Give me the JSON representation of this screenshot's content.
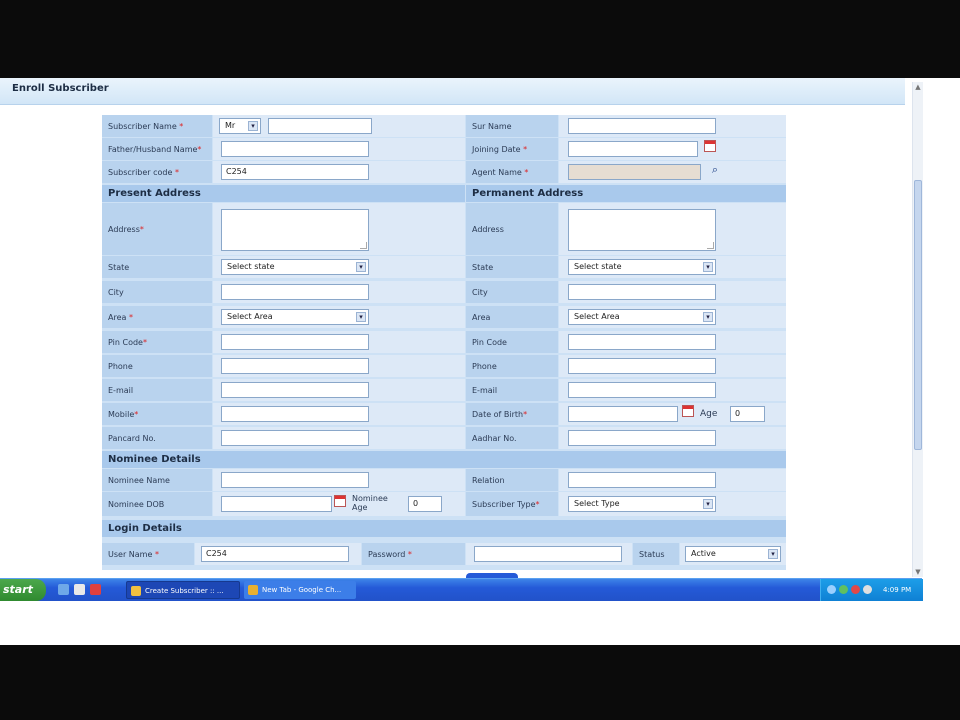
{
  "page": {
    "title": "Enroll Subscriber"
  },
  "form": {
    "subscriber_name": {
      "label": "Subscriber Name",
      "title_value": "Mr",
      "value": ""
    },
    "father_husband_name": {
      "label": "Father/Husband Name",
      "value": ""
    },
    "subscriber_code": {
      "label": "Subscriber code",
      "value": "C254"
    },
    "sur_name": {
      "label": "Sur Name",
      "value": ""
    },
    "joining_date": {
      "label": "Joining Date",
      "value": ""
    },
    "agent_name": {
      "label": "Agent Name",
      "value": ""
    },
    "present_address": {
      "heading": "Present Address",
      "address_label": "Address",
      "address_value": "",
      "state_label": "State",
      "state_value": "Select state",
      "city_label": "City",
      "city_value": "",
      "area_label": "Area",
      "area_value": "Select Area",
      "pin_label": "Pin Code",
      "pin_value": "",
      "phone_label": "Phone",
      "phone_value": "",
      "email_label": "E-mail",
      "email_value": "",
      "mobile_label": "Mobile",
      "mobile_value": "",
      "pancard_label": "Pancard No.",
      "pancard_value": ""
    },
    "permanent_address": {
      "heading": "Permanent Address",
      "address_label": "Address",
      "address_value": "",
      "state_label": "State",
      "state_value": "Select state",
      "city_label": "City",
      "city_value": "",
      "area_label": "Area",
      "area_value": "Select Area",
      "pin_label": "Pin Code",
      "pin_value": "",
      "phone_label": "Phone",
      "phone_value": "",
      "email_label": "E-mail",
      "email_value": "",
      "dob_label": "Date of Birth",
      "dob_value": "",
      "age_label": "Age",
      "age_value": "0",
      "aadhar_label": "Aadhar No.",
      "aadhar_value": ""
    },
    "nominee": {
      "heading": "Nominee Details",
      "name_label": "Nominee Name",
      "name_value": "",
      "relation_label": "Relation",
      "relation_value": "",
      "dob_label": "Nominee DOB",
      "dob_value": "",
      "age_label": "Nominee Age",
      "age_value": "0",
      "type_label": "Subscriber Type",
      "type_value": "Select Type"
    },
    "login": {
      "heading": "Login Details",
      "username_label": "User Name",
      "username_value": "C254",
      "password_label": "Password",
      "password_value": "",
      "status_label": "Status",
      "status_value": "Active"
    }
  },
  "taskbar": {
    "start_label": "start",
    "tasks": [
      "Create Subscriber :: ...",
      "New Tab - Google Ch..."
    ],
    "clock": "4:09 PM"
  },
  "colors": {
    "form_bg": "#cde1f5",
    "label_bg": "#b9d3ee",
    "section_bg": "#a9c9ec",
    "taskbar": "#245ad8",
    "start": "#2f8a2f"
  }
}
